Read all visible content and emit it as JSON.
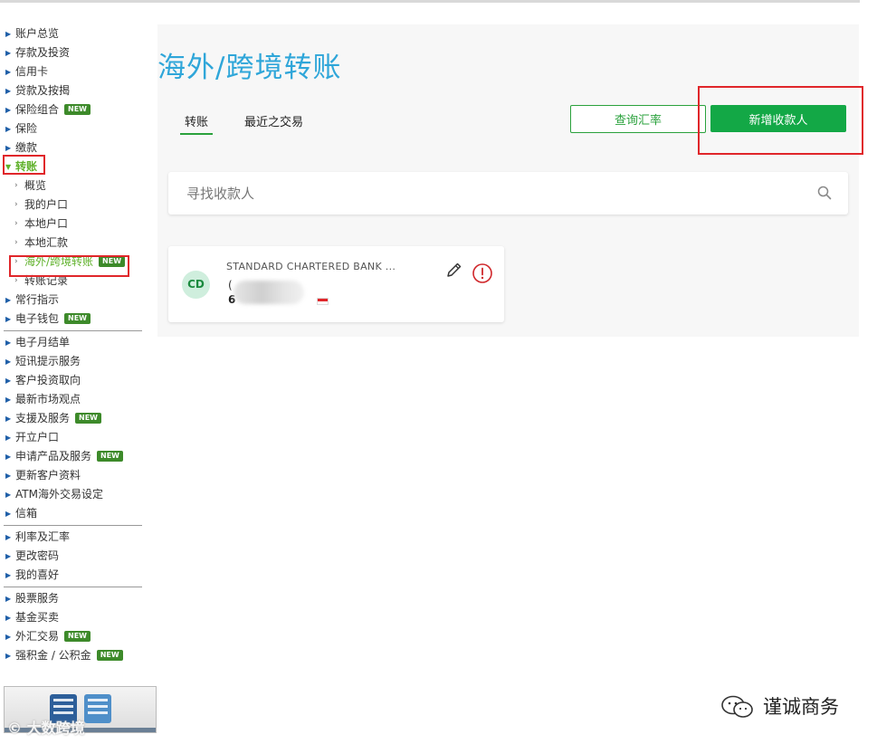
{
  "sidebar": {
    "items": [
      {
        "label": "账户总览"
      },
      {
        "label": "存款及投资"
      },
      {
        "label": "信用卡"
      },
      {
        "label": "贷款及按揭"
      },
      {
        "label": "保险组合",
        "badge": "NEW"
      },
      {
        "label": "保险"
      },
      {
        "label": "缴款"
      },
      {
        "label": "转账"
      },
      {
        "label": "概览"
      },
      {
        "label": "我的户口"
      },
      {
        "label": "本地户口"
      },
      {
        "label": "本地汇款"
      },
      {
        "label": "海外/跨境转账",
        "badge": "NEW"
      },
      {
        "label": "转账记录"
      },
      {
        "label": "常行指示"
      },
      {
        "label": "电子钱包",
        "badge": "NEW"
      },
      {
        "label": "电子月结单"
      },
      {
        "label": "短讯提示服务"
      },
      {
        "label": "客户投资取向"
      },
      {
        "label": "最新市场观点"
      },
      {
        "label": "支援及服务",
        "badge": "NEW"
      },
      {
        "label": "开立户口"
      },
      {
        "label": "申请产品及服务",
        "badge": "NEW"
      },
      {
        "label": "更新客户资料"
      },
      {
        "label": "ATM海外交易设定"
      },
      {
        "label": "信箱"
      },
      {
        "label": "利率及汇率"
      },
      {
        "label": "更改密码"
      },
      {
        "label": "我的喜好"
      },
      {
        "label": "股票服务"
      },
      {
        "label": "基金买卖"
      },
      {
        "label": "外汇交易",
        "badge": "NEW"
      },
      {
        "label": "强积金 / 公积金",
        "badge": "NEW"
      }
    ]
  },
  "main": {
    "title": "海外/跨境转账",
    "tabs": [
      {
        "label": "转账"
      },
      {
        "label": "最近之交易"
      }
    ],
    "buttons": {
      "rate": "查询汇率",
      "add": "新增收款人"
    },
    "search": {
      "placeholder": "寻找收款人"
    },
    "payee": {
      "initials": "CD",
      "bank": "STANDARD CHARTERED BANK ...",
      "line1": "(",
      "line2": "6"
    }
  },
  "watermarks": {
    "left": "© 大数跨境",
    "right": "谨诚商务"
  },
  "colors": {
    "accent_green": "#13a846",
    "title_blue": "#2fa6d9",
    "highlight_red": "#e0262a",
    "badge_green": "#3d8a2a"
  }
}
